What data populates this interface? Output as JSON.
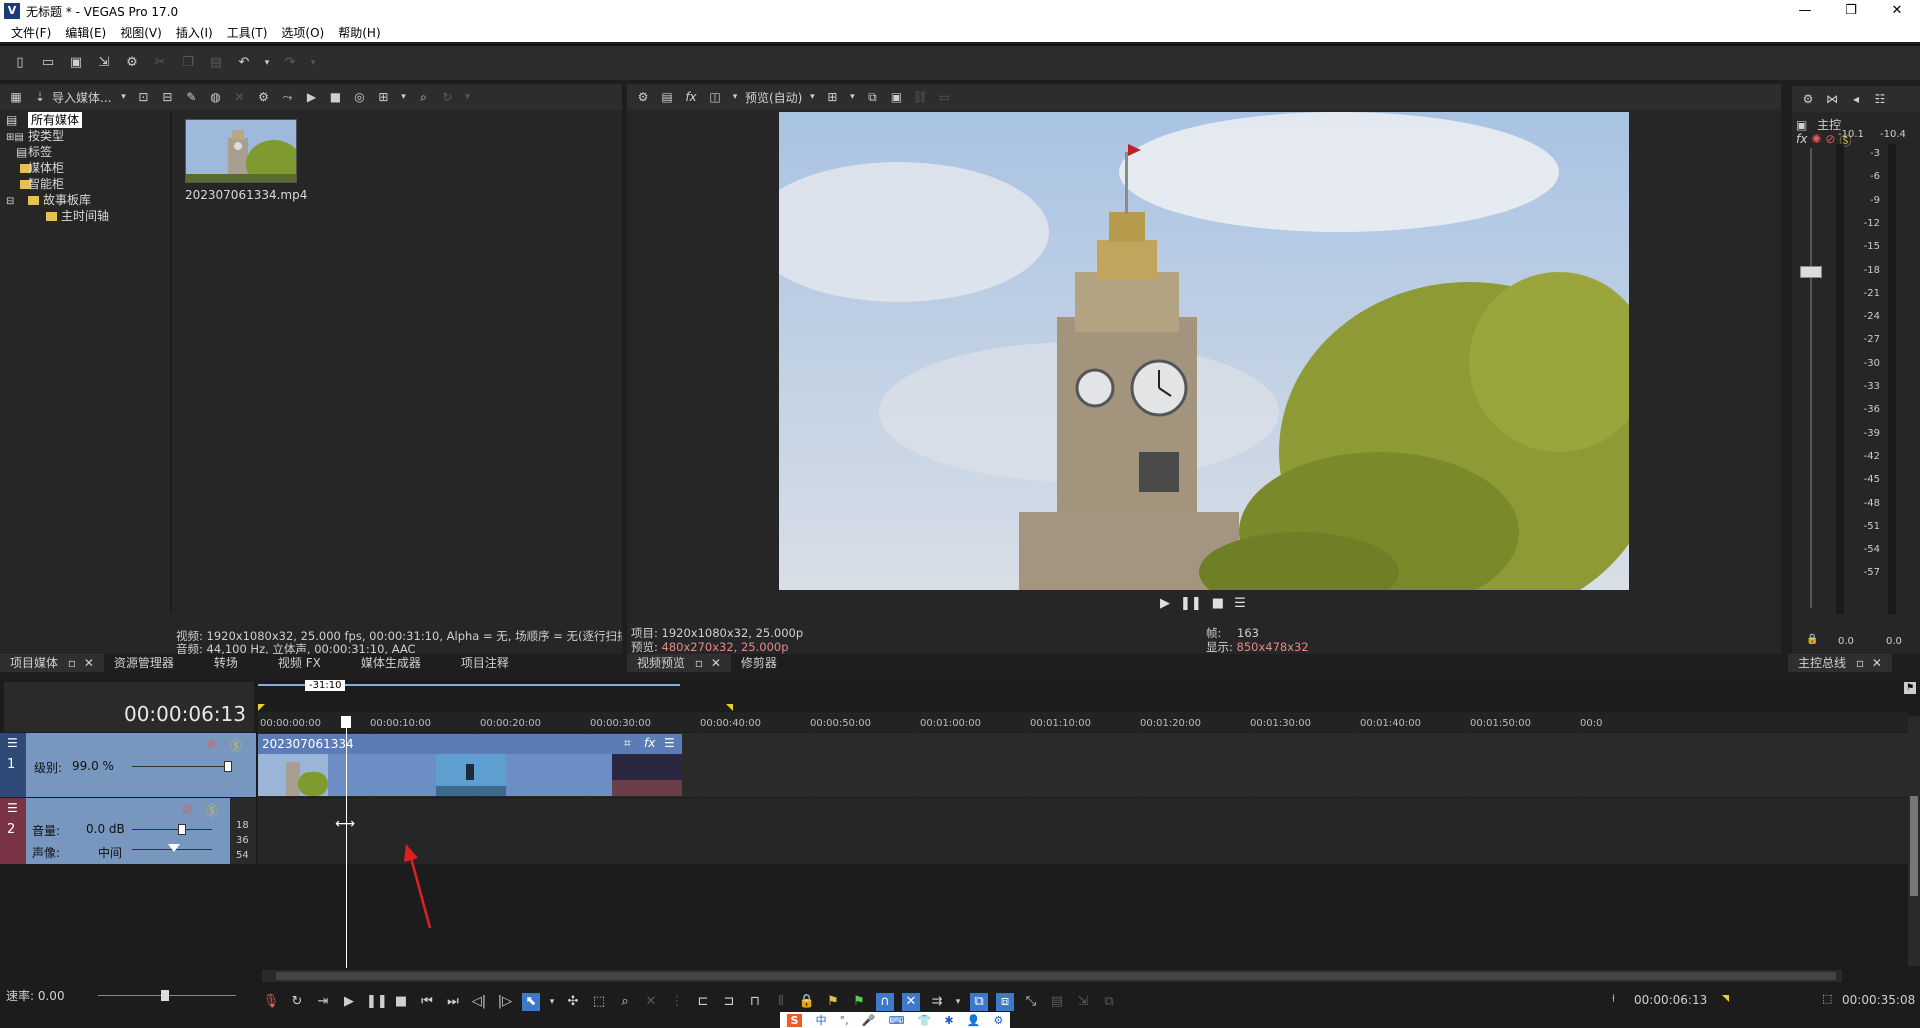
{
  "window": {
    "title": "无标题 * - VEGAS Pro 17.0",
    "app_icon": "V",
    "controls": [
      "—",
      "❐",
      "✕"
    ]
  },
  "menu": [
    "文件(F)",
    "编辑(E)",
    "视图(V)",
    "插入(I)",
    "工具(T)",
    "选项(O)",
    "帮助(H)"
  ],
  "media_panel": {
    "import_label": "导入媒体...",
    "tree": [
      "所有媒体",
      "按类型",
      "标签",
      "媒体柜",
      "智能柜",
      "故事板库",
      "主时间轴"
    ],
    "file_name": "202307061334.mp4",
    "info_video": "视频: 1920x1080x32, 25.000 fps, 00:00:31:10, Alpha = 无, 场顺序 = 无(逐行扫描",
    "info_audio": "音频: 44,100 Hz, 立体声, 00:00:31:10, AAC",
    "tabs": [
      "项目媒体",
      "资源管理器",
      "转场",
      "视频 FX",
      "媒体生成器",
      "项目注释"
    ]
  },
  "preview": {
    "mode_label": "预览(自动)",
    "project_info_label": "项目:",
    "project_info": "1920x1080x32, 25.000p",
    "preview_info_label": "预览:",
    "preview_info": "480x270x32, 25.000p",
    "frame_label": "帧:",
    "frame": "163",
    "display_label": "显示:",
    "display": "850x478x32",
    "tabs": [
      "视频预览",
      "修剪器"
    ]
  },
  "master": {
    "label": "主控",
    "left_peak": "-10.1",
    "right_peak": "-10.4",
    "scale": [
      "-3",
      "-6",
      "-9",
      "-12",
      "-15",
      "-18",
      "-21",
      "-24",
      "-27",
      "-30",
      "-33",
      "-36",
      "-39",
      "-42",
      "-45",
      "-48",
      "-51",
      "-54",
      "-57"
    ],
    "bottom_left": "0.0",
    "bottom_right": "0.0",
    "tab": "主控总线"
  },
  "timeline": {
    "timecode": "00:00:06:13",
    "loop_label": "-31:10",
    "ruler": [
      "00:00:00:00",
      "00:00:10:00",
      "00:00:20:00",
      "00:00:30:00",
      "00:00:40:00",
      "00:00:50:00",
      "00:01:00:00",
      "00:01:10:00",
      "00:01:20:00",
      "00:01:30:00",
      "00:01:40:00",
      "00:01:50:00",
      "00:0"
    ],
    "video_track": {
      "num": "1",
      "level_label": "级别:",
      "level": "99.0 %",
      "level_fraction": 0.99,
      "clip_name": "202307061334"
    },
    "audio_track": {
      "num": "2",
      "vol_label": "音量:",
      "vol": "0.0 dB",
      "pan_label": "声像:",
      "pan": "中间",
      "db_marks": [
        "18",
        "36",
        "54"
      ]
    },
    "rate_label": "速率: 0.00",
    "cursor_time": "00:00:06:13",
    "end_time": "00:00:35:08"
  },
  "taskbar_icons": [
    "S",
    "中",
    "°,",
    "🎤",
    "⌨",
    "👕",
    "✱",
    "👤",
    "⚙"
  ]
}
